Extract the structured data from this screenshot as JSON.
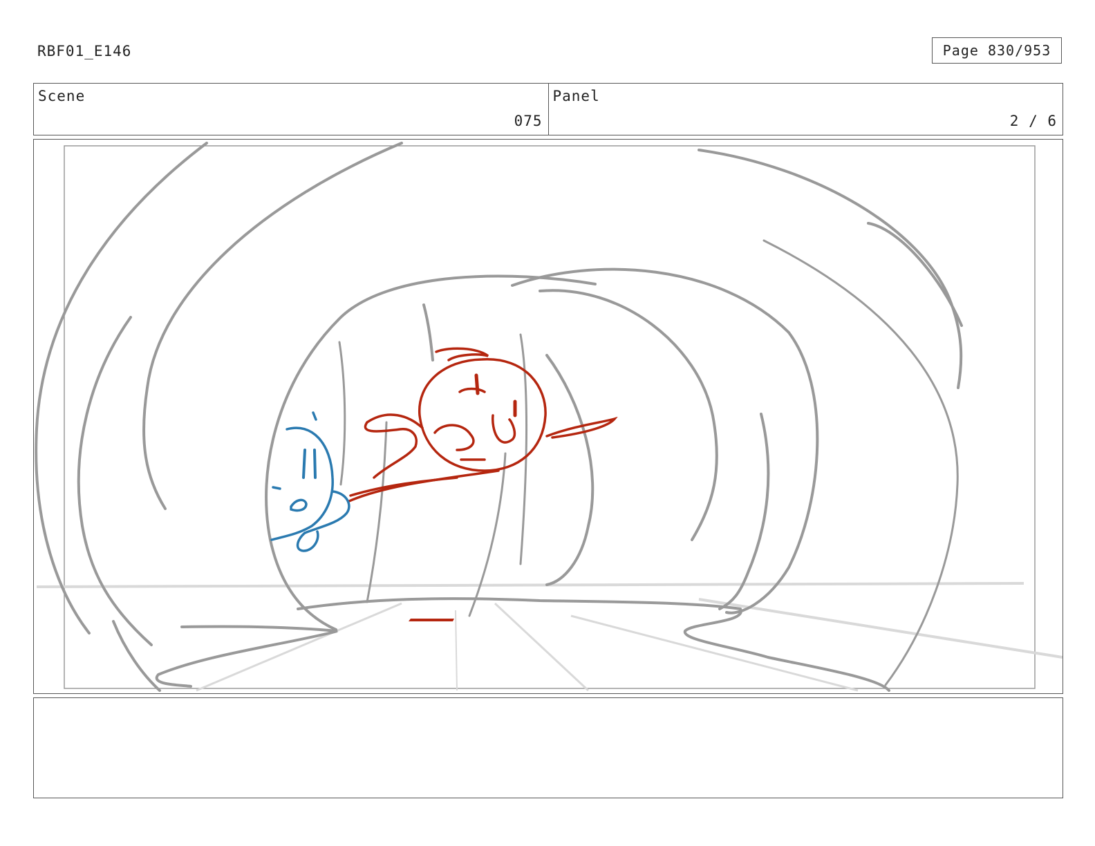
{
  "header": {
    "project_id": "RBF01_E146",
    "page_label": "Page 830/953"
  },
  "scene": {
    "label": "Scene",
    "value": "075"
  },
  "panel": {
    "label": "Panel",
    "value": "2 / 6"
  },
  "drawing": {
    "environment_color": "#999999",
    "floor_color": "#d9d9d9",
    "character_red_color": "#b5260f",
    "character_blue_color": "#2a7ab0"
  },
  "notes": {
    "text": ""
  }
}
